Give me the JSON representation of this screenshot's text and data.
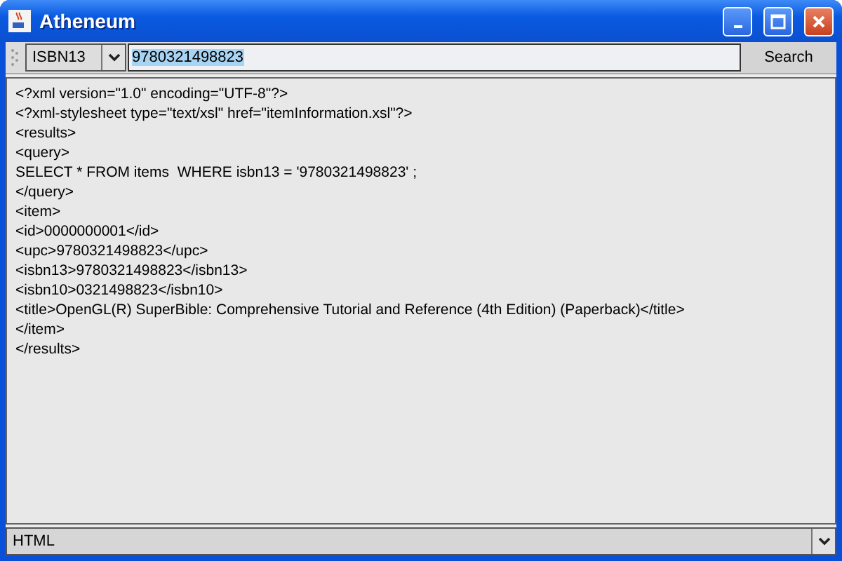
{
  "window": {
    "title": "Atheneum"
  },
  "toolbar": {
    "search_type": "ISBN13",
    "query": {
      "value": "9780321498823",
      "text_selected": true
    },
    "search_button": "Search"
  },
  "document": {
    "lines": [
      "<?xml version=\"1.0\" encoding=\"UTF-8\"?>",
      "<?xml-stylesheet type=\"text/xsl\" href=\"itemInformation.xsl\"?>",
      "<results>",
      "<query>",
      "SELECT * FROM items  WHERE isbn13 = '9780321498823' ;",
      "</query>",
      "<item>",
      "<id>0000000001</id>",
      "<upc>9780321498823</upc>",
      "<isbn13>9780321498823</isbn13>",
      "<isbn10>0321498823</isbn10>",
      "<title>OpenGL(R) SuperBible: Comprehensive Tutorial and Reference (4th Edition) (Paperback)</title>",
      "</item>",
      "</results>"
    ]
  },
  "format": {
    "value": "HTML"
  }
}
